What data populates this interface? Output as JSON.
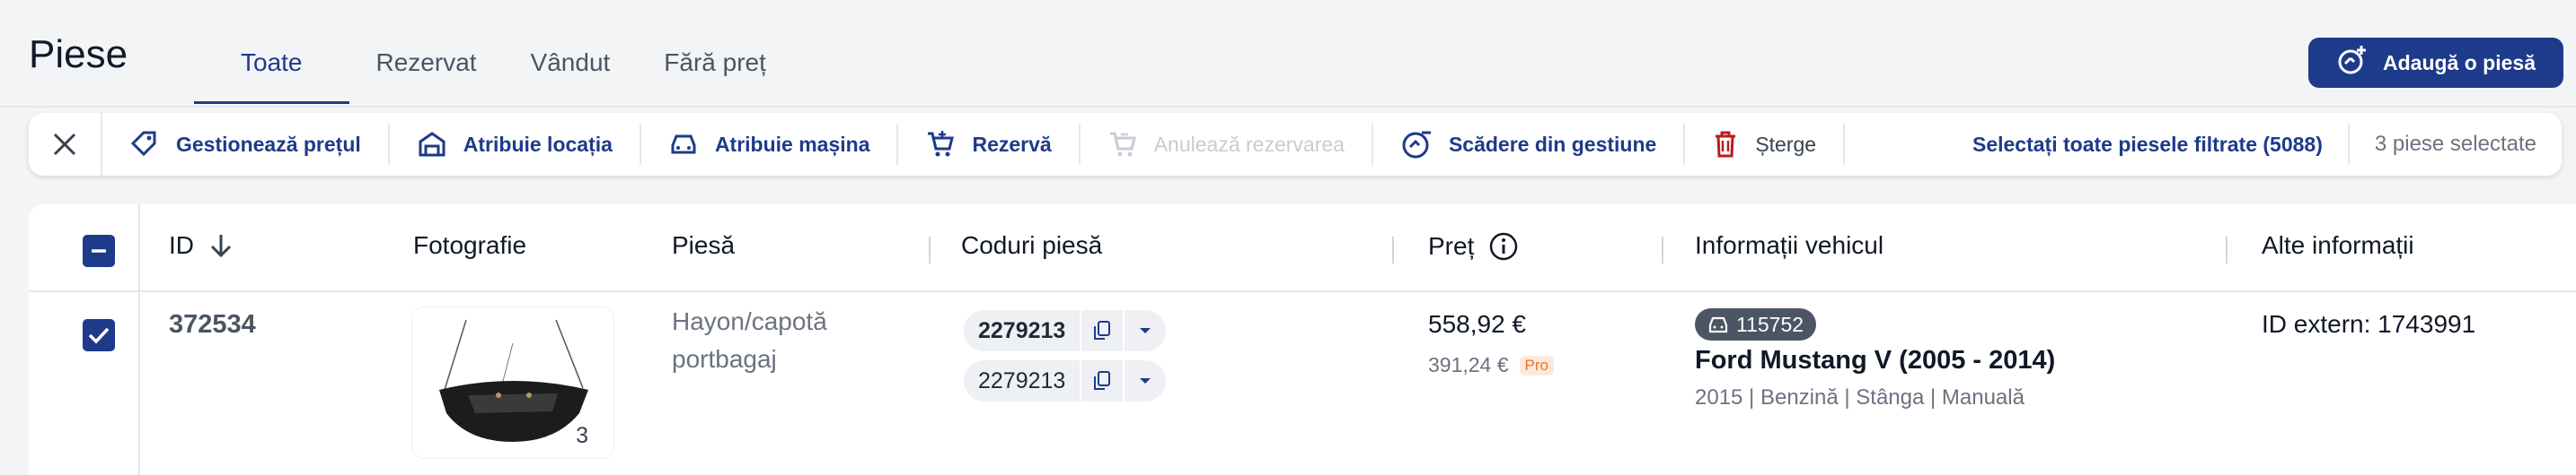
{
  "page": {
    "title": "Piese"
  },
  "tabs": [
    {
      "label": "Toate",
      "active": true
    },
    {
      "label": "Rezervat",
      "active": false
    },
    {
      "label": "Vândut",
      "active": false
    },
    {
      "label": "Fără preț",
      "active": false
    }
  ],
  "add_button": {
    "label": "Adaugă o piesă",
    "icon": "add-part-icon"
  },
  "toolbar": {
    "actions": [
      {
        "label": "Gestionează prețul",
        "icon": "price-tag-icon",
        "enabled": true
      },
      {
        "label": "Atribuie locația",
        "icon": "warehouse-icon",
        "enabled": true
      },
      {
        "label": "Atribuie mașina",
        "icon": "car-icon",
        "enabled": true
      },
      {
        "label": "Rezervă",
        "icon": "cart-add-icon",
        "enabled": true
      },
      {
        "label": "Anulează rezervarea",
        "icon": "cart-remove-icon",
        "enabled": false
      },
      {
        "label": "Scădere din gestiune",
        "icon": "deduct-icon",
        "enabled": true
      },
      {
        "label": "Șterge",
        "icon": "trash-icon",
        "enabled": true
      }
    ],
    "select_all": "Selectați toate piesele filtrate (5088)",
    "selected_count": "3 piese selectate"
  },
  "table": {
    "headers": {
      "id": "ID",
      "photo": "Fotografie",
      "piece": "Piesă",
      "codes": "Coduri piesă",
      "price": "Preț",
      "vehicle": "Informații vehicul",
      "other": "Alte informații"
    },
    "rows": [
      {
        "checked": true,
        "id": "372534",
        "photo_count": "3",
        "piece": "Hayon/capotă portbagaj",
        "codes": [
          "2279213",
          "2279213"
        ],
        "price": "558,92 €",
        "price_sub": "391,24 €",
        "price_badge": "Pro",
        "vehicle_id": "115752",
        "vehicle_name": "Ford Mustang V (2005 - 2014)",
        "vehicle_meta": "2015 | Benzină | Stânga | Manuală",
        "other": "ID extern: 1743991"
      }
    ]
  },
  "colors": {
    "primary": "#1e3a8a",
    "danger": "#b91c1c",
    "accent": "#f97316"
  }
}
